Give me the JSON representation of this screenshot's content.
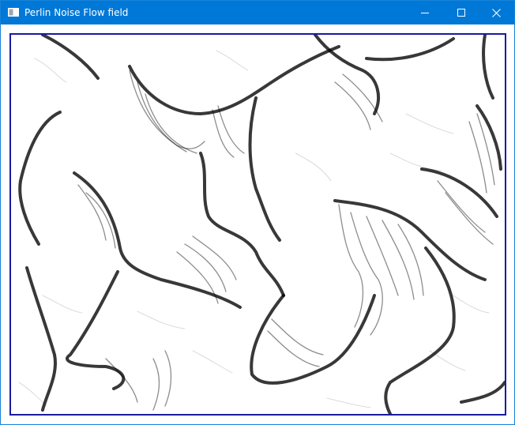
{
  "window": {
    "title": "Perlin Noise Flow field",
    "controls": {
      "minimize_icon": "minimize-icon",
      "maximize_icon": "maximize-icon",
      "close_icon": "close-icon"
    }
  },
  "colors": {
    "titlebar": "#0078d7",
    "frame_border": "#1a1aa0",
    "stroke": "#000000",
    "background": "#ffffff"
  },
  "canvas": {
    "content": "flow-field-strokes"
  }
}
